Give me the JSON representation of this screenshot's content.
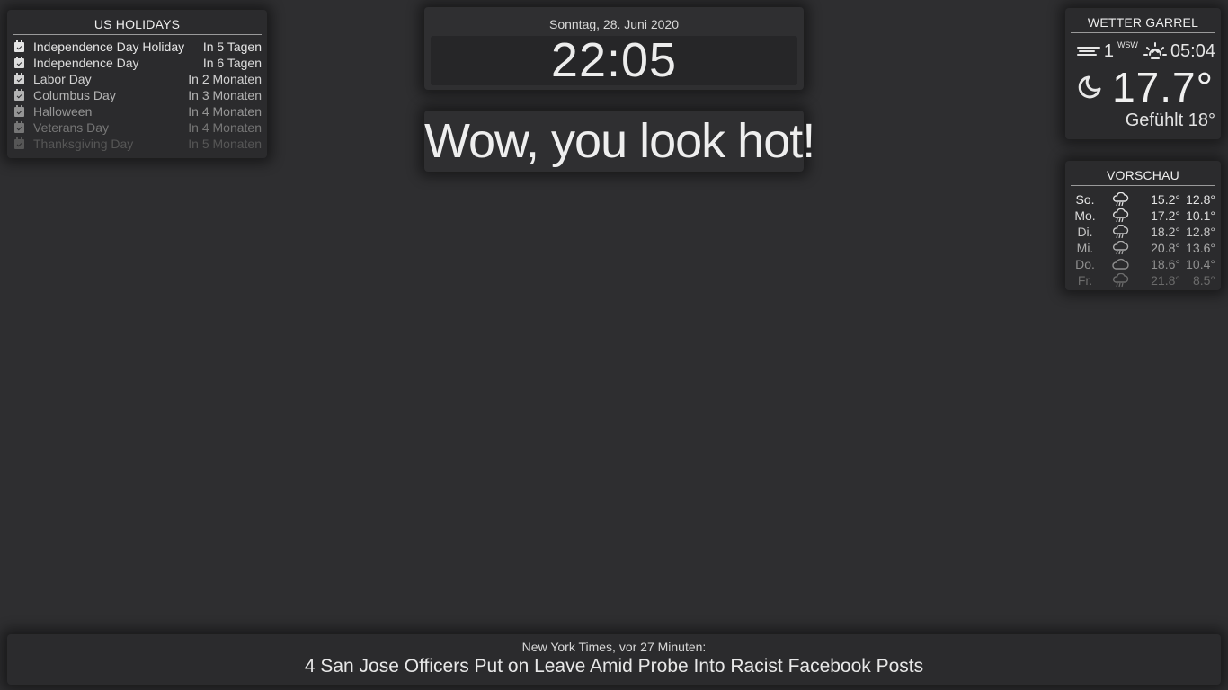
{
  "holidays": {
    "title": "US HOLIDAYS",
    "items": [
      {
        "name": "Independence Day Holiday",
        "when": "In 5 Tagen",
        "color": "#e6e6e6"
      },
      {
        "name": "Independence Day",
        "when": "In 6 Tagen",
        "color": "#dedede"
      },
      {
        "name": "Labor Day",
        "when": "In 2 Monaten",
        "color": "#d2d2d2"
      },
      {
        "name": "Columbus Day",
        "when": "In 3 Monaten",
        "color": "#b4b4b4"
      },
      {
        "name": "Halloween",
        "when": "In 4 Monaten",
        "color": "#959595"
      },
      {
        "name": "Veterans Day",
        "when": "In 4 Monaten",
        "color": "#767676"
      },
      {
        "name": "Thanksgiving Day",
        "when": "In 5 Monaten",
        "color": "#565656"
      }
    ]
  },
  "clock": {
    "date": "Sonntag, 28. Juni 2020",
    "time": "22:05"
  },
  "compliment": {
    "text": "Wow, you look hot!"
  },
  "weather": {
    "title": "WETTER GARREL",
    "wind_speed": "1",
    "wind_direction": "WSW",
    "sun_time": "05:04",
    "temperature": "17.7°",
    "feels_like": "Gefühlt 18°",
    "icons": {
      "wind": "wind-icon",
      "sun": "sunrise-icon",
      "condition": "moon-icon"
    }
  },
  "forecast": {
    "title": "VORSCHAU",
    "days": [
      {
        "day": "So.",
        "icon": "rain-icon",
        "max": "15.2°",
        "min": "12.8°",
        "color": "#e6e6e6"
      },
      {
        "day": "Mo.",
        "icon": "rain-icon",
        "max": "17.2°",
        "min": "10.1°",
        "color": "#dadada"
      },
      {
        "day": "Di.",
        "icon": "rain-icon",
        "max": "18.2°",
        "min": "12.8°",
        "color": "#c6c6c6"
      },
      {
        "day": "Mi.",
        "icon": "rain-icon",
        "max": "20.8°",
        "min": "13.6°",
        "color": "#adadad"
      },
      {
        "day": "Do.",
        "icon": "cloud-icon",
        "max": "18.6°",
        "min": "10.4°",
        "color": "#8e8e8e"
      },
      {
        "day": "Fr.",
        "icon": "rain-icon",
        "max": "21.8°",
        "min": "8.5°",
        "color": "#6c6c6c"
      }
    ]
  },
  "news": {
    "source": "New York Times, vor 27 Minuten:",
    "headline": "4 San Jose Officers Put on Leave Amid Probe Into Racist Facebook Posts"
  }
}
